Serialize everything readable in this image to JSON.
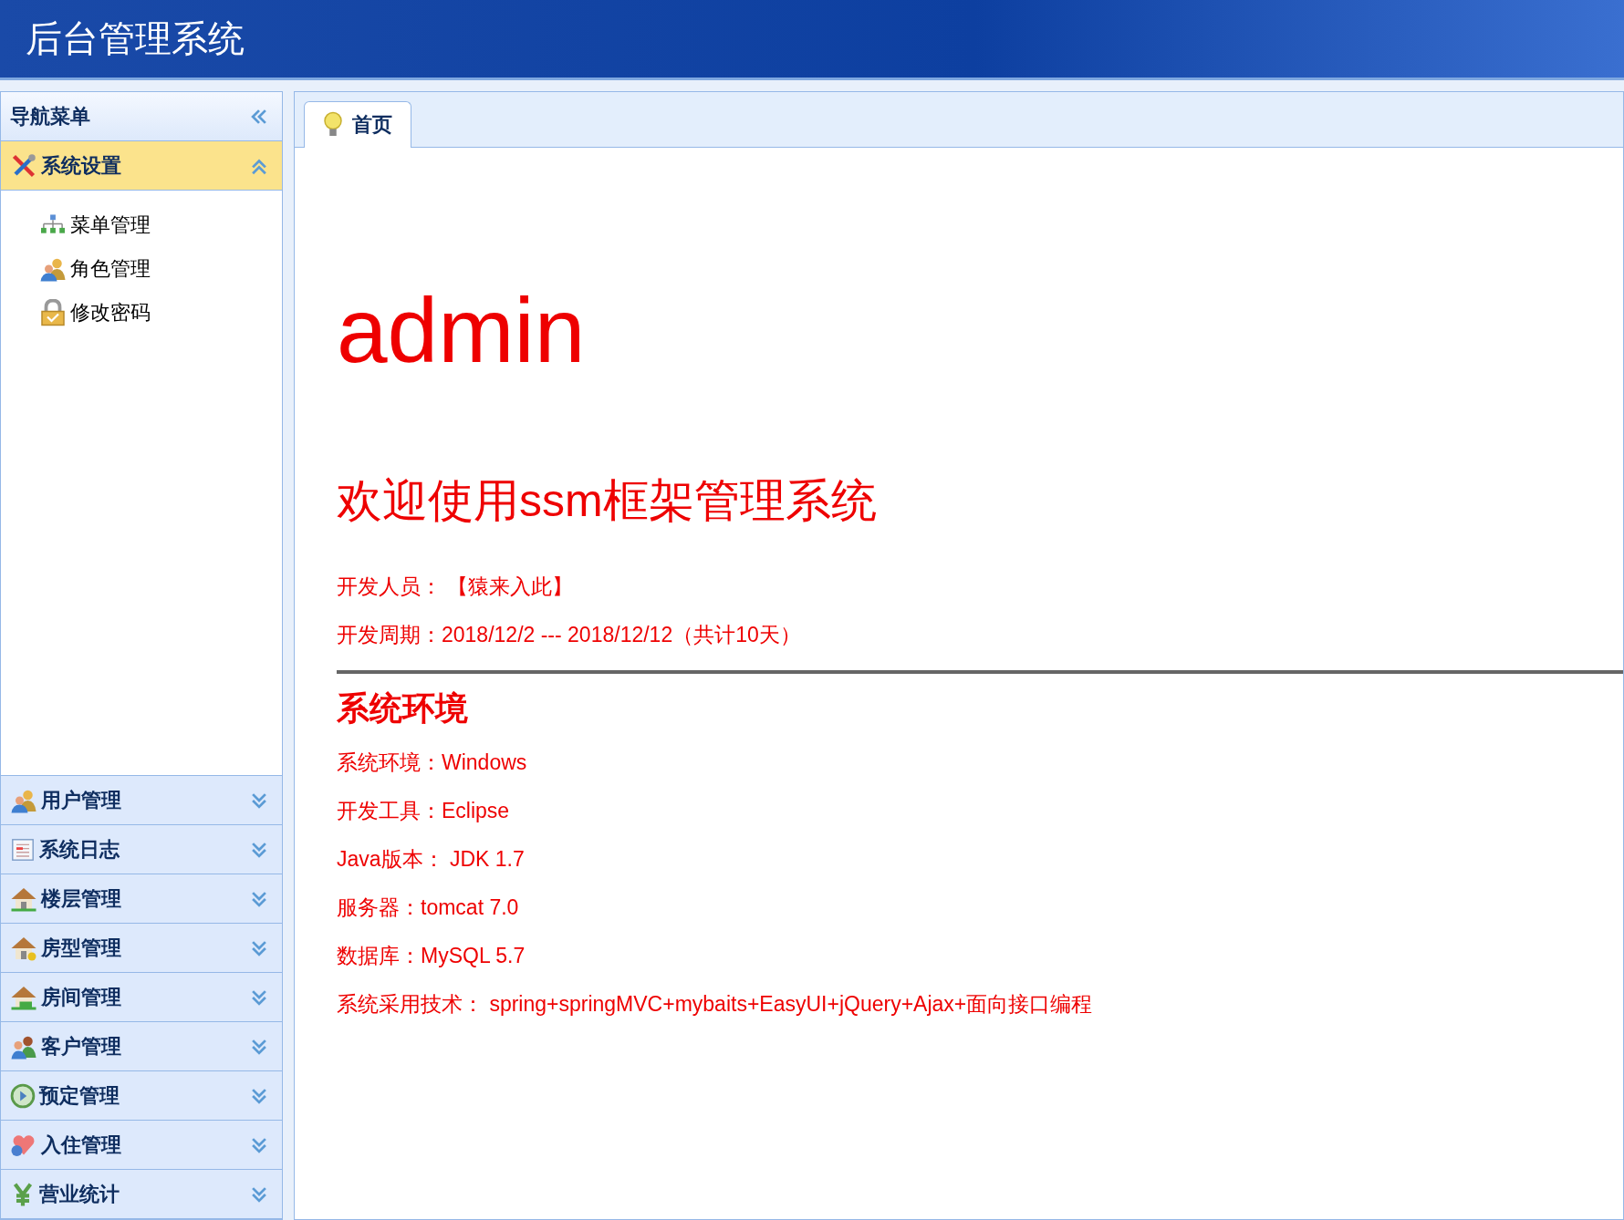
{
  "header": {
    "title": "后台管理系统"
  },
  "sidebar": {
    "title": "导航菜单",
    "sections": [
      {
        "label": "系统设置",
        "expanded": true,
        "items": [
          {
            "label": "菜单管理"
          },
          {
            "label": "角色管理"
          },
          {
            "label": "修改密码"
          }
        ]
      },
      {
        "label": "用户管理",
        "expanded": false
      },
      {
        "label": "系统日志",
        "expanded": false
      },
      {
        "label": "楼层管理",
        "expanded": false
      },
      {
        "label": "房型管理",
        "expanded": false
      },
      {
        "label": "房间管理",
        "expanded": false
      },
      {
        "label": "客户管理",
        "expanded": false
      },
      {
        "label": "预定管理",
        "expanded": false
      },
      {
        "label": "入住管理",
        "expanded": false
      },
      {
        "label": "营业统计",
        "expanded": false
      }
    ]
  },
  "tabs": [
    {
      "label": "首页",
      "selected": true
    }
  ],
  "content": {
    "user": "admin",
    "welcome": "欢迎使用ssm框架管理系统",
    "info": [
      "开发人员： 【猿来入此】",
      "开发周期：2018/12/2 --- 2018/12/12（共计10天）"
    ],
    "env_title": "系统环境",
    "env": [
      "系统环境：Windows",
      "开发工具：Eclipse",
      "Java版本： JDK 1.7",
      "服务器：tomcat 7.0",
      "数据库：MySQL 5.7",
      "系统采用技术： spring+springMVC+mybaits+EasyUI+jQuery+Ajax+面向接口编程"
    ]
  }
}
